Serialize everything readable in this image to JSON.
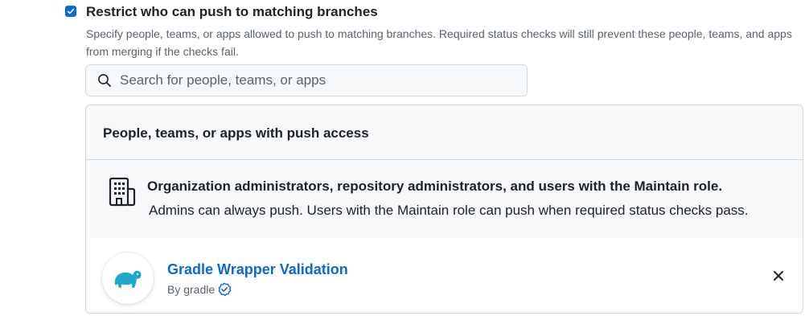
{
  "rule": {
    "checked": true,
    "title": "Restrict who can push to matching branches",
    "description": "Specify people, teams, or apps allowed to push to matching branches. Required status checks will still prevent these people, teams, and apps from merging if the checks fail."
  },
  "search": {
    "placeholder": "Search for people, teams, or apps",
    "value": ""
  },
  "panel": {
    "header": "People, teams, or apps with push access",
    "admins": {
      "icon": "organization-icon",
      "title": "Organization administrators, repository administrators, and users with the Maintain role.",
      "description": "Admins can always push. Users with the Maintain role can push when required status checks pass."
    },
    "apps": [
      {
        "name": "Gradle Wrapper Validation",
        "by": "By gradle",
        "verified": true,
        "avatar_icon": "gradle-elephant-icon",
        "avatar_color": "#02303a",
        "logo_color": "#1ba8cb"
      }
    ]
  },
  "colors": {
    "accent": "#0969da",
    "muted_text": "#59636e",
    "border": "#d1d9e0",
    "subtle_bg": "#f6f8fa"
  }
}
